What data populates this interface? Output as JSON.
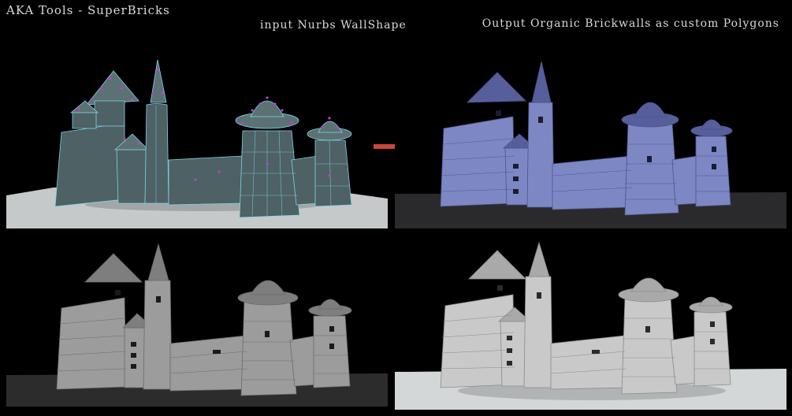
{
  "header": {
    "app_title": "AKA Tools - SuperBricks",
    "caption_input": "input Nurbs WallShape",
    "caption_output": "Output Organic Brickwalls as custom Polygons"
  },
  "colors": {
    "background": "#000000",
    "caption_text": "#d9d9d9",
    "nurbs_surface": "#4e6164",
    "nurbs_wire": "#7fd6e6",
    "nurbs_cv": "#c43bd0",
    "brick_blue": "#7d87c4",
    "brick_gray": "#9c9c9c",
    "brick_light": "#c9c9c9",
    "ground_light": "#d4d7d8",
    "arrow": "#c9473c"
  },
  "panels": [
    {
      "name": "input-nurbs-render",
      "style": "nurbs"
    },
    {
      "name": "output-brick-render-blue",
      "style": "blue"
    },
    {
      "name": "brick-render-gray-dark",
      "style": "gray"
    },
    {
      "name": "brick-render-light",
      "style": "light"
    }
  ],
  "icons": {
    "arrow": "arrow-right-icon"
  }
}
